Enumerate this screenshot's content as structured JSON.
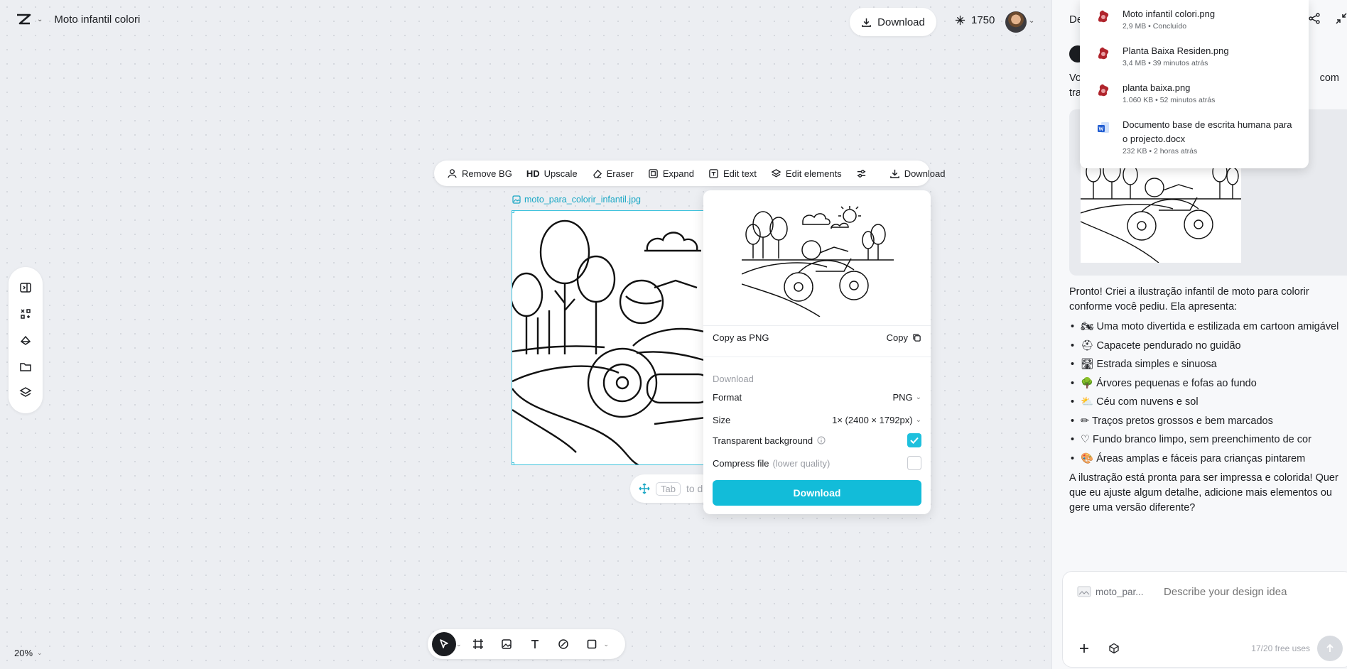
{
  "header": {
    "project_title": "Moto infantil colori",
    "download_label": "Download",
    "credits": "1750"
  },
  "left_rail": {
    "items": [
      "panel-toggle-icon",
      "tools-icon",
      "eraser-layers-icon",
      "folder-icon",
      "layers-icon"
    ]
  },
  "image_toolbar": {
    "remove_bg": "Remove BG",
    "upscale_hd": "HD",
    "upscale": "Upscale",
    "eraser": "Eraser",
    "expand": "Expand",
    "edit_text": "Edit text",
    "edit_elements": "Edit elements",
    "download": "Download"
  },
  "canvas": {
    "file_name": "moto_para_colorir_infantil.jpg",
    "tab_key": "Tab",
    "tab_hint": "to de",
    "zoom": "20%"
  },
  "download_popover": {
    "copy_as_png": "Copy as PNG",
    "copy": "Copy",
    "section_title": "Download",
    "format_label": "Format",
    "format_value": "PNG",
    "size_label": "Size",
    "size_value": "1× (2400 × 1792px)",
    "transparent_label": "Transparent background",
    "transparent_checked": true,
    "compress_label": "Compress file",
    "compress_hint": "(lower quality)",
    "compress_checked": false,
    "download_button": "Download"
  },
  "right_panel": {
    "title_partial": "De",
    "intro_partial_1": "Vo",
    "intro_partial_2": "com",
    "intro_partial_3": "tra",
    "answer_intro": "Pronto! Criei a ilustração infantil de moto para colorir conforme você pediu. Ela apresenta:",
    "bullets": [
      {
        "emoji": "🏍",
        "text": "Uma moto divertida e estilizada em cartoon amigável"
      },
      {
        "emoji": "⛑",
        "text": "Capacete pendurado no guidão"
      },
      {
        "emoji": "🛣",
        "text": "Estrada simples e sinuosa"
      },
      {
        "emoji": "🌳",
        "text": "Árvores pequenas e fofas ao fundo"
      },
      {
        "emoji": "⛅",
        "text": "Céu com nuvens e sol"
      },
      {
        "emoji": "✏",
        "text": "Traços pretos grossos e bem marcados"
      },
      {
        "emoji": "♡",
        "text": "Fundo branco limpo, sem preenchimento de cor"
      },
      {
        "emoji": "🎨",
        "text": "Áreas amplas e fáceis para crianças pintarem"
      }
    ],
    "closing": "A ilustração está pronta para ser impressa e colorida! Quer que eu ajuste algum detalhe, adicione mais elementos ou gere uma versão diferente?",
    "composer": {
      "attachment": "moto_par...",
      "placeholder": "Describe your design idea",
      "uses": "17/20 free uses"
    }
  },
  "downloads": [
    {
      "name": "Moto infantil colori.png",
      "meta": "2,9 MB • Concluído",
      "icon": "image-file-icon"
    },
    {
      "name": "Planta Baixa Residen.png",
      "meta": "3,4 MB • 39 minutos atrás",
      "icon": "image-file-icon"
    },
    {
      "name": "planta baixa.png",
      "meta": "1.060 KB • 52 minutos atrás",
      "icon": "image-file-icon"
    },
    {
      "name": "Documento base de escrita humana para o projecto.docx",
      "meta": "232 KB • 2 horas atrás",
      "icon": "word-file-icon"
    }
  ],
  "colors": {
    "accent": "#12bcd9",
    "selection": "#3fc3dd",
    "canvas_bg": "#eceef2"
  }
}
